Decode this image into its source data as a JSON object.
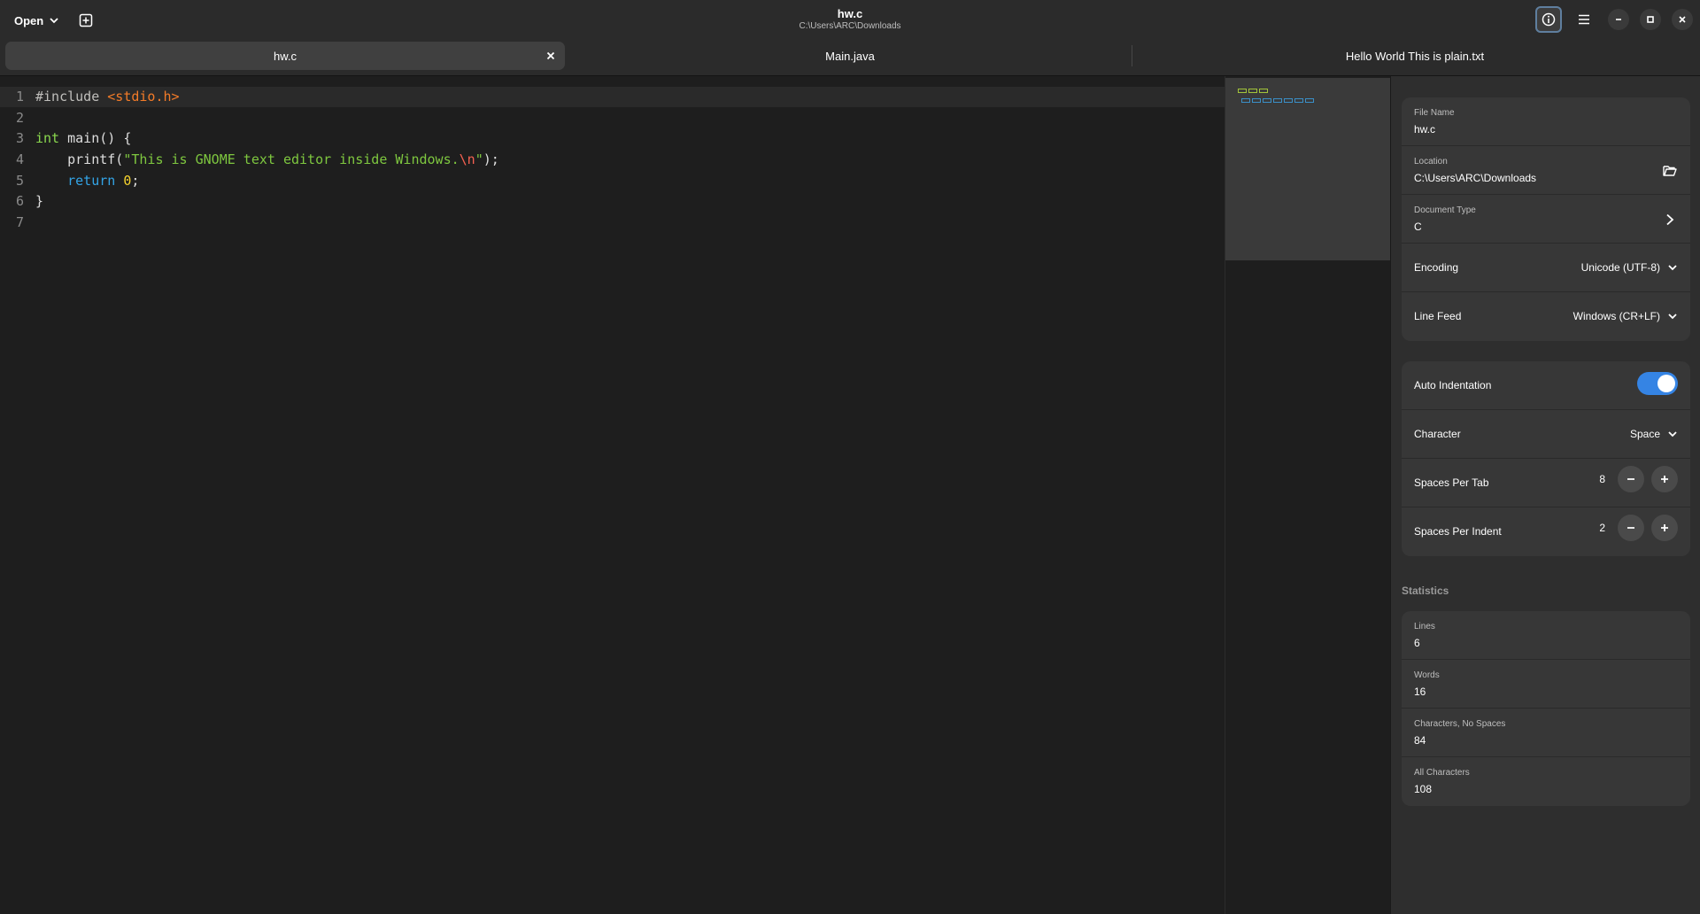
{
  "header": {
    "open_label": "Open",
    "title": "hw.c",
    "subtitle": "C:\\Users\\ARC\\Downloads"
  },
  "tabs": [
    {
      "label": "hw.c",
      "active": true
    },
    {
      "label": "Main.java",
      "active": false
    },
    {
      "label": "Hello World This is plain.txt",
      "active": false
    }
  ],
  "editor": {
    "line_numbers": [
      "1",
      "2",
      "3",
      "4",
      "5",
      "6",
      "7"
    ],
    "lines": [
      [
        {
          "t": "#include ",
          "c": "pre"
        },
        {
          "t": "<stdio.h>",
          "c": "inc"
        }
      ],
      [],
      [
        {
          "t": "int",
          "c": "type"
        },
        {
          "t": " main() {",
          "c": "plain"
        }
      ],
      [
        {
          "t": "    printf(",
          "c": "plain"
        },
        {
          "t": "\"This is GNOME text editor inside Windows.",
          "c": "str"
        },
        {
          "t": "\\n",
          "c": "esc"
        },
        {
          "t": "\"",
          "c": "str"
        },
        {
          "t": ");",
          "c": "plain"
        }
      ],
      [
        {
          "t": "    ",
          "c": "plain"
        },
        {
          "t": "return",
          "c": "kw"
        },
        {
          "t": " ",
          "c": "plain"
        },
        {
          "t": "0",
          "c": "num"
        },
        {
          "t": ";",
          "c": "plain"
        }
      ],
      [
        {
          "t": "}",
          "c": "plain"
        }
      ],
      []
    ]
  },
  "properties": {
    "file_name_label": "File Name",
    "file_name": "hw.c",
    "location_label": "Location",
    "location": "C:\\Users\\ARC\\Downloads",
    "doc_type_label": "Document Type",
    "doc_type": "C",
    "encoding_label": "Encoding",
    "encoding": "Unicode (UTF-8)",
    "line_feed_label": "Line Feed",
    "line_feed": "Windows (CR+LF)"
  },
  "indentation": {
    "auto_label": "Auto Indentation",
    "auto_enabled": true,
    "character_label": "Character",
    "character": "Space",
    "spaces_per_tab_label": "Spaces Per Tab",
    "spaces_per_tab": "8",
    "spaces_per_indent_label": "Spaces Per Indent",
    "spaces_per_indent": "2"
  },
  "statistics": {
    "title": "Statistics",
    "lines_label": "Lines",
    "lines": "6",
    "words_label": "Words",
    "words": "16",
    "chars_nospace_label": "Characters, No Spaces",
    "chars_nospace": "84",
    "all_chars_label": "All Characters",
    "all_chars": "108"
  },
  "colors": {
    "accent": "#3584e4",
    "preprocessor": "#c0bfbc",
    "include": "#f37b28",
    "type": "#8ad84e",
    "string": "#7ec73f",
    "escape": "#f66151",
    "keyword": "#33a4e6",
    "number": "#f6d32d"
  },
  "icons": {
    "open_chevron": "chevron-down-icon",
    "new_tab": "new-tab-icon",
    "info": "info-icon",
    "menu": "hamburger-menu-icon",
    "minimize": "minimize-icon",
    "maximize": "maximize-icon",
    "close": "close-icon",
    "folder": "folder-open-icon",
    "chevron_right": "chevron-right-icon"
  }
}
